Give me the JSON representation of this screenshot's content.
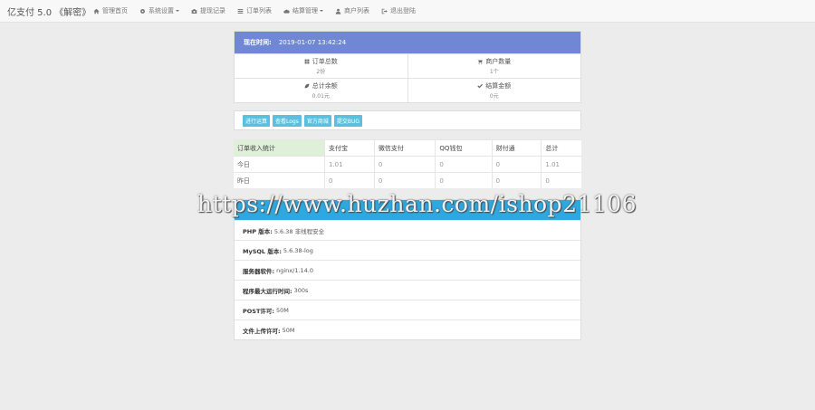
{
  "navbar": {
    "brand": "亿支付 5.0 《解密》",
    "items": [
      {
        "label": "管理首页",
        "icon": "home-icon",
        "dropdown": false
      },
      {
        "label": "系统设置",
        "icon": "gear-icon",
        "dropdown": true
      },
      {
        "label": "提现记录",
        "icon": "camera-icon",
        "dropdown": false
      },
      {
        "label": "订单列表",
        "icon": "list-icon",
        "dropdown": false
      },
      {
        "label": "结算管理",
        "icon": "cloud-icon",
        "dropdown": true
      },
      {
        "label": "商户列表",
        "icon": "user-icon",
        "dropdown": false
      },
      {
        "label": "退出登陆",
        "icon": "logout-icon",
        "dropdown": false
      }
    ]
  },
  "overview": {
    "time_label": "现在时间:",
    "time_value": "2019-01-07 13:42:24",
    "stats": [
      {
        "label": "订单总数",
        "value": "2份",
        "icon": "grid-icon"
      },
      {
        "label": "商户数量",
        "value": "1个",
        "icon": "cart-icon"
      },
      {
        "label": "总计余额",
        "value": "0.01元",
        "icon": "leaf-icon"
      },
      {
        "label": "结算金额",
        "value": "0元",
        "icon": "check-icon"
      }
    ]
  },
  "quick_links": [
    "进行运算",
    "查看Logs",
    "官方商城",
    "提交BUG"
  ],
  "income_table": {
    "headers": [
      "订单收入统计",
      "支付宝",
      "微信支付",
      "QQ钱包",
      "财付通",
      "总计"
    ],
    "rows": [
      {
        "name": "今日",
        "values": [
          "1.01",
          "0",
          "0",
          "0",
          "1.01"
        ]
      },
      {
        "name": "昨日",
        "values": [
          "0",
          "0",
          "0",
          "0",
          "0"
        ]
      }
    ]
  },
  "server_info": {
    "rows": [
      {
        "label": "PHP 版本:",
        "value": "5.6.38 非线程安全"
      },
      {
        "label": "MySQL 版本:",
        "value": "5.6.38-log"
      },
      {
        "label": "服务器软件:",
        "value": "nginx/1.14.0"
      },
      {
        "label": "程序最大运行时间:",
        "value": "300s"
      },
      {
        "label": "POST许可:",
        "value": "50M"
      },
      {
        "label": "文件上传许可:",
        "value": "50M"
      }
    ]
  },
  "watermark": "https://www.huzhan.com/ishop21106",
  "colors": {
    "panel_header": "#6f87d4",
    "server_header": "#2ea8e0",
    "link_btn": "#5bc0de",
    "table_highlight": "#dff0d8"
  }
}
